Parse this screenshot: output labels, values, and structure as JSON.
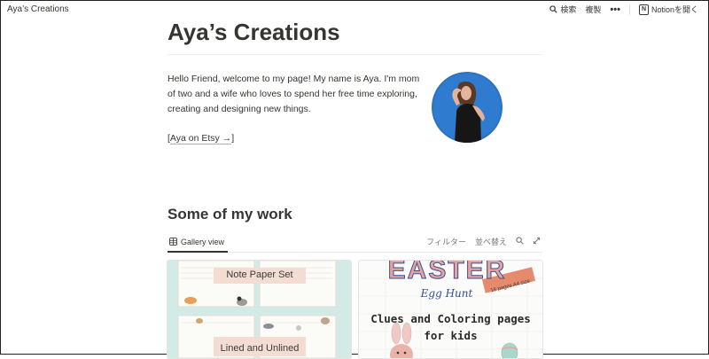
{
  "window": {
    "title": "Aya’s Creations"
  },
  "topbar": {
    "search_label": "検索",
    "duplicate_label": "複製",
    "more_label": "•••",
    "open_in_notion_label": "Notionを開く",
    "notion_logo_letter": "N"
  },
  "page": {
    "title": "Aya’s Creations",
    "intro": "Hello Friend, welcome to my page! My name is Aya. I'm mom of two and a wife who loves to spend her free time exploring, creating and designing new things.",
    "etsy_bracket_open": "[",
    "etsy_link": "Aya on Etsy →",
    "etsy_bracket_close": "]"
  },
  "gallery": {
    "heading": "Some of my work",
    "view_tab": "Gallery view",
    "filter_label": "フィルター",
    "sort_label": "並べ替え",
    "cards": [
      {
        "title": "Note Paper Set",
        "subtitle": "Lined and Unlined"
      },
      {
        "banner": "EASTER",
        "script": "Egg Hunt",
        "tag": "16 pages A4 size",
        "title_line1": "Clues and Coloring pages",
        "title_line2": "for kids"
      }
    ]
  },
  "colors": {
    "text": "#37352f",
    "muted": "#787774",
    "card1_bg": "#d3ebe6",
    "avatar_bg": "#2b73c0",
    "easter_blue": "#3a4f8f",
    "easter_pink": "#e8a3a0",
    "easter_mint": "#9fd3c7"
  }
}
